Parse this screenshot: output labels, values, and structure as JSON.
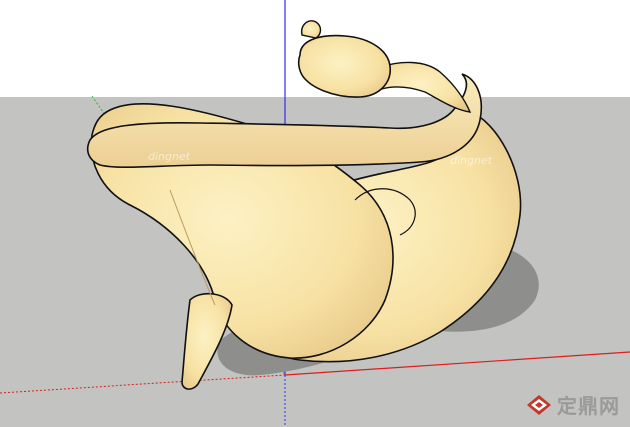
{
  "viewport": {
    "sky_color": "#ffffff",
    "ground_color": "#c3c3c1",
    "axis_colors": {
      "blue": "#2f2ff0",
      "red": "#e01c1c",
      "green": "#25c025"
    }
  },
  "model": {
    "fill_color": "#f7e4a8",
    "shade_color": "#e8c98a",
    "shadow_color": "#8e8e8c",
    "outline_color": "#111111"
  },
  "watermark": {
    "text": "定鼎网",
    "logo_color": "#c0392b",
    "logo_icon": "diamond-logo-icon",
    "ghost_text": "dingnet"
  }
}
